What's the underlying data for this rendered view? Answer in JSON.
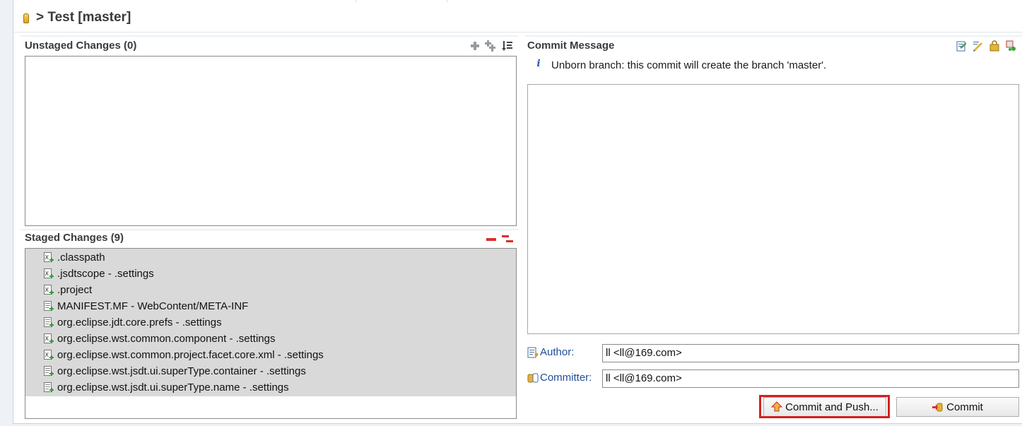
{
  "header": {
    "title": "> Test [master]"
  },
  "unstaged": {
    "title": "Unstaged Changes (0)",
    "toolbar": [
      "add-icon",
      "add-all-icon",
      "sort-icon"
    ]
  },
  "staged": {
    "title": "Staged Changes (9)",
    "toolbar": [
      "remove-icon",
      "remove-all-icon"
    ],
    "files": [
      {
        "label": ".classpath",
        "icon": "xml-file-icon"
      },
      {
        "label": ".jsdtscope - .settings",
        "icon": "xml-file-icon"
      },
      {
        "label": ".project",
        "icon": "xml-file-icon"
      },
      {
        "label": "MANIFEST.MF - WebContent/META-INF",
        "icon": "text-file-icon"
      },
      {
        "label": "org.eclipse.jdt.core.prefs - .settings",
        "icon": "text-file-icon"
      },
      {
        "label": "org.eclipse.wst.common.component - .settings",
        "icon": "xml-file-icon"
      },
      {
        "label": "org.eclipse.wst.common.project.facet.core.xml - .settings",
        "icon": "xml-file-icon"
      },
      {
        "label": "org.eclipse.wst.jsdt.ui.superType.container - .settings",
        "icon": "text-file-icon"
      },
      {
        "label": "org.eclipse.wst.jsdt.ui.superType.name - .settings",
        "icon": "text-file-icon"
      }
    ]
  },
  "commit_message": {
    "title": "Commit Message",
    "info": "Unborn branch: this commit will create the branch 'master'.",
    "toolbar": [
      "amend-icon",
      "sign-off-icon",
      "gerrit-icon",
      "compare-icon"
    ],
    "text": ""
  },
  "author": {
    "label": "Author:",
    "value": "ll <ll@169.com>"
  },
  "committer": {
    "label": "Committer:",
    "value": "ll <ll@169.com>"
  },
  "buttons": {
    "commit_and_push": "Commit and Push...",
    "commit": "Commit"
  }
}
